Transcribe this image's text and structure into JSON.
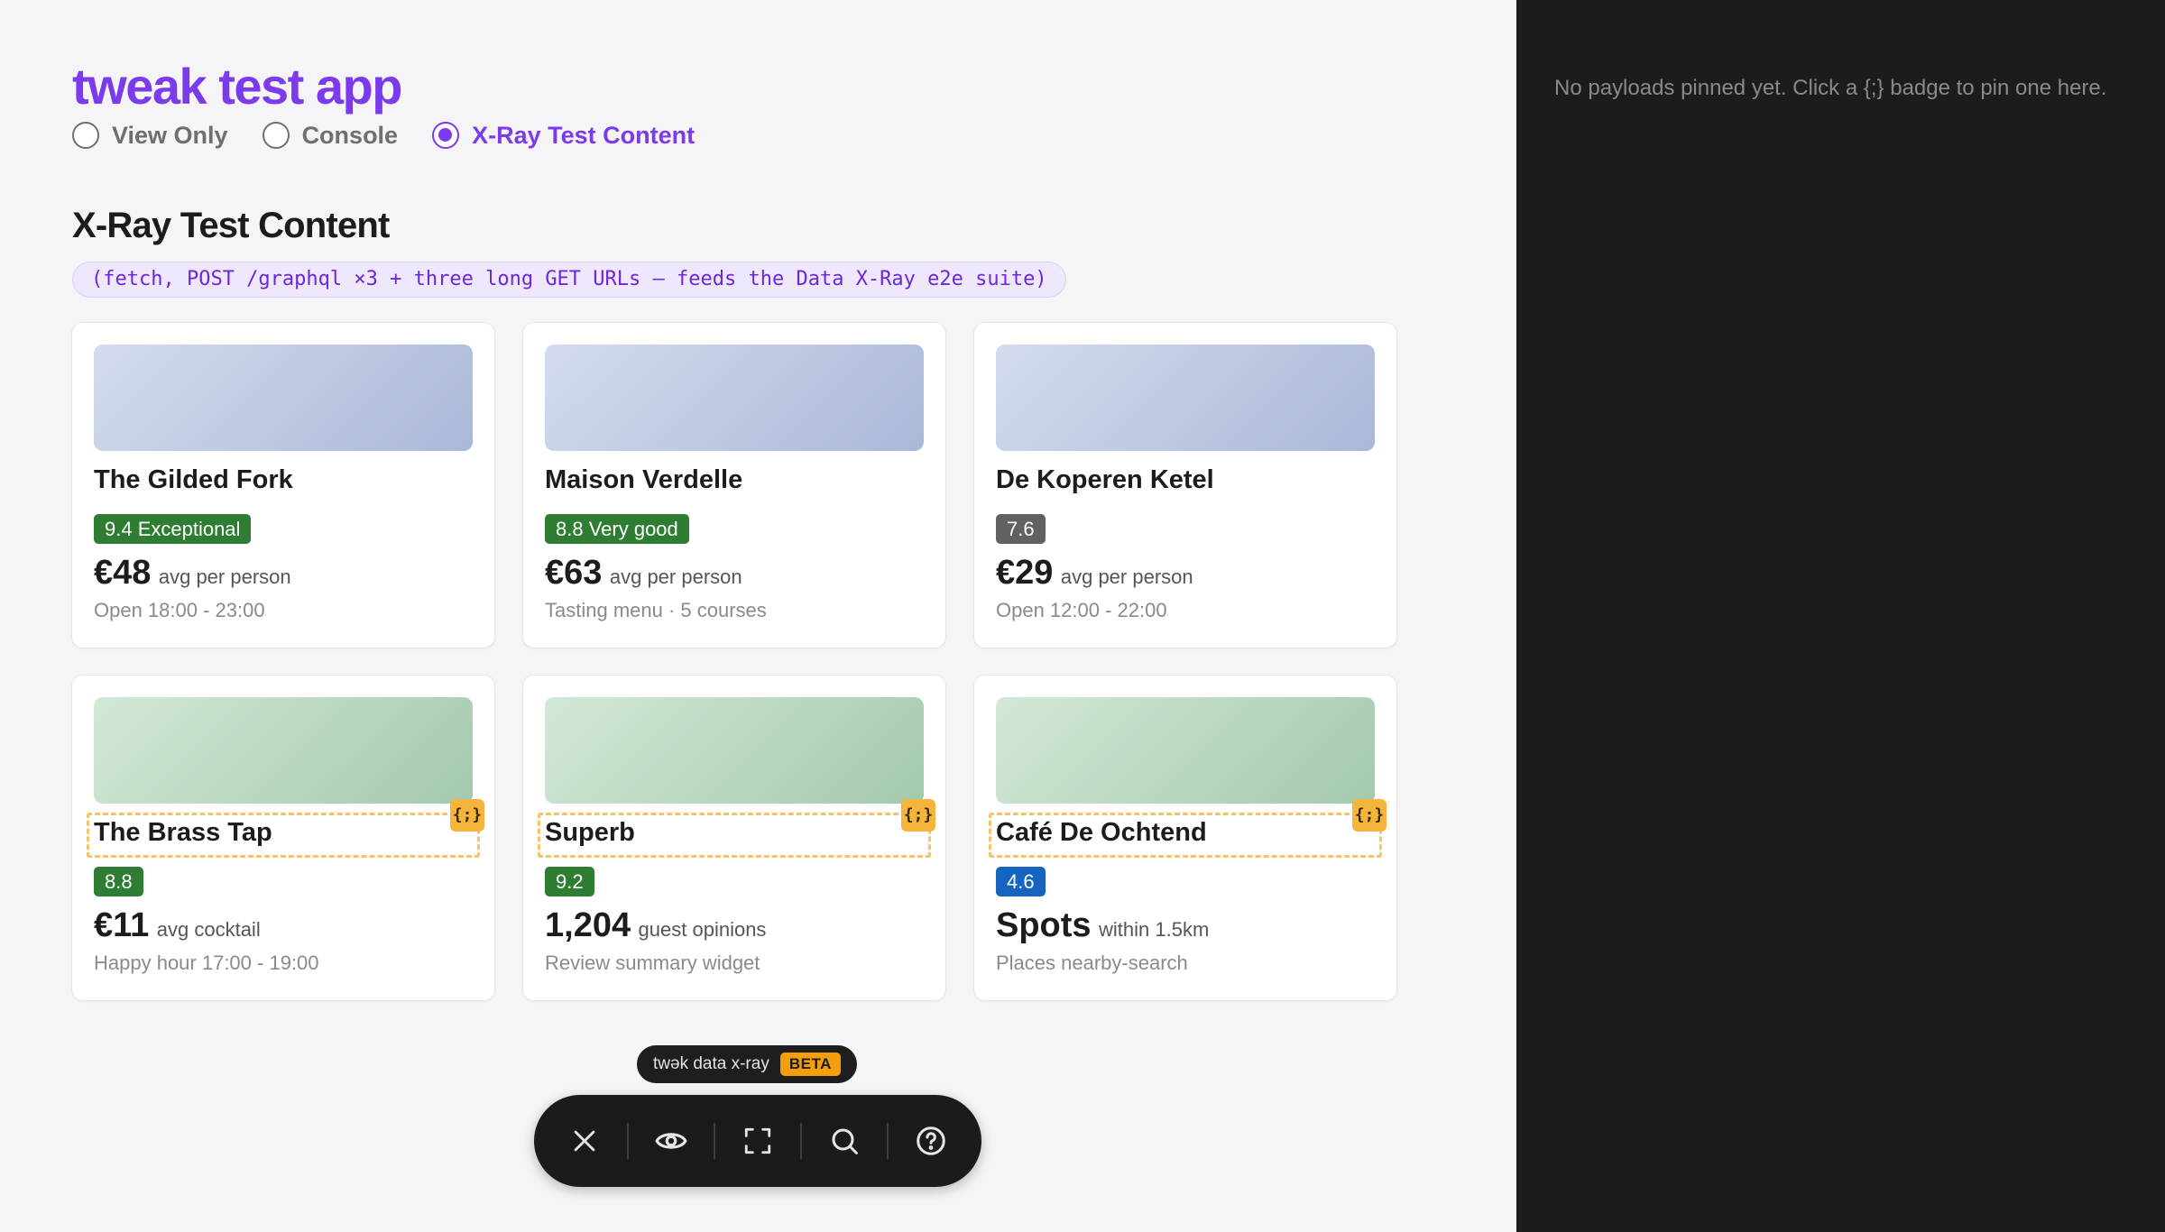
{
  "app": {
    "title": "tweak test app"
  },
  "modes": [
    {
      "label": "View Only",
      "selected": false
    },
    {
      "label": "Console",
      "selected": false
    },
    {
      "label": "X-Ray Test Content",
      "selected": true
    }
  ],
  "section": {
    "title": "X-Ray Test Content",
    "code_note": "(fetch, POST /graphql ×3 + three long GET URLs — feeds the Data X-Ray e2e suite)"
  },
  "cards": [
    {
      "name": "The Gilded Fork",
      "badge": "9.4 Exceptional",
      "badge_color": "#2e7d32",
      "price": "€48",
      "unit": "avg per person",
      "sub": "Open 18:00 - 23:00"
    },
    {
      "name": "Maison Verdelle",
      "badge": "8.8 Very good",
      "badge_color": "#2e7d32",
      "price": "€63",
      "unit": "avg per person",
      "sub": "Tasting menu · 5 courses"
    },
    {
      "name": "De Koperen Ketel",
      "badge": "7.6",
      "badge_color": "#616161",
      "price": "€29",
      "unit": "avg per person",
      "sub": "Open 12:00 - 22:00"
    },
    {
      "name": "The Brass Tap",
      "badge": "8.8",
      "badge_color": "#2e7d32",
      "price": "€11",
      "unit": "avg cocktail",
      "sub": "Happy hour 17:00 - 19:00",
      "xray_badge": "{;}"
    },
    {
      "name": "Superb",
      "badge": "9.2",
      "badge_color": "#2e7d32",
      "price": "1,204",
      "unit": "guest opinions",
      "sub": "Review summary widget",
      "xray_badge": "{;}"
    },
    {
      "name": "Café De Ochtend",
      "badge": "4.6",
      "badge_color": "#1565c0",
      "price": "Spots",
      "unit": "within 1.5km",
      "sub": "Places nearby-search",
      "xray_badge": "{;}"
    }
  ],
  "sidebar": {
    "message": "No payloads pinned yet. Click a {;} badge to pin one here."
  },
  "tweak": {
    "label": "twək data x-ray",
    "beta": "BETA"
  },
  "toolbar": {
    "buttons": [
      {
        "icon": "close-icon"
      },
      {
        "icon": "eye-icon"
      },
      {
        "icon": "fullscreen-icon"
      },
      {
        "icon": "search-icon"
      },
      {
        "icon": "help-icon"
      }
    ]
  }
}
